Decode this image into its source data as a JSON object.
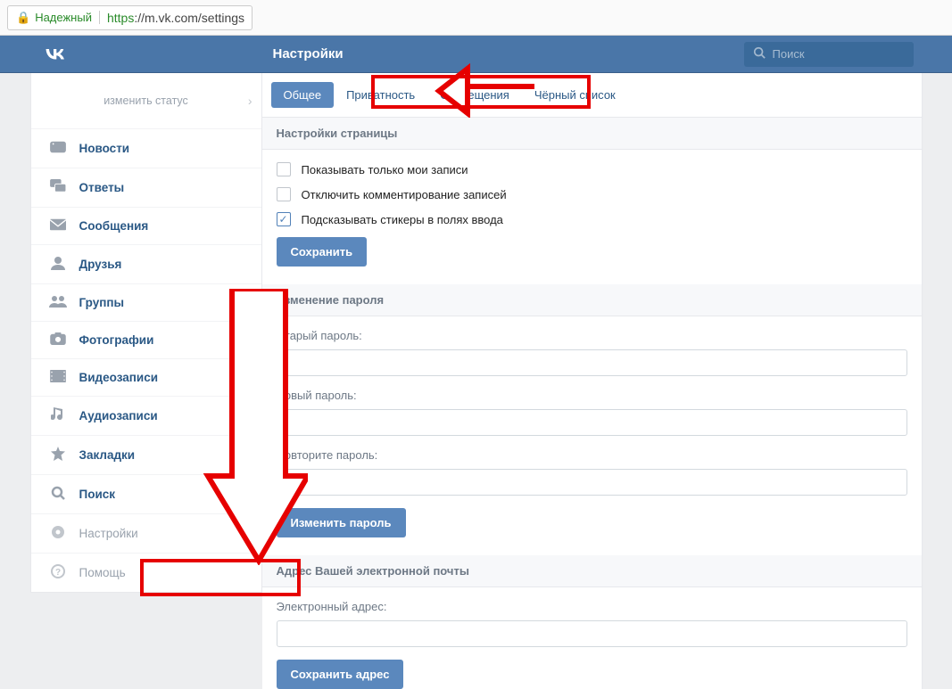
{
  "browser": {
    "secure_label": "Надежный",
    "url_https": "https",
    "url_rest": "://m.vk.com/settings"
  },
  "header": {
    "title": "Настройки",
    "search_placeholder": "Поиск"
  },
  "sidebar": {
    "status_label": "изменить статус",
    "items": {
      "news": "Новости",
      "replies": "Ответы",
      "messages": "Сообщения",
      "friends": "Друзья",
      "groups": "Группы",
      "photos": "Фотографии",
      "videos": "Видеозаписи",
      "audio": "Аудиозаписи",
      "bookmarks": "Закладки",
      "search": "Поиск",
      "settings": "Настройки",
      "help": "Помощь"
    }
  },
  "tabs": {
    "general": "Общее",
    "privacy": "Приватность",
    "notifications": "Оповещения",
    "blacklist": "Чёрный список"
  },
  "page_settings": {
    "heading": "Настройки страницы",
    "only_my_posts": "Показывать только мои записи",
    "disable_comments": "Отключить комментирование записей",
    "suggest_stickers": "Подсказывать стикеры в полях ввода",
    "save": "Сохранить"
  },
  "password": {
    "heading": "Изменение пароля",
    "old": "Старый пароль:",
    "new": "Новый пароль:",
    "repeat": "Повторите пароль:",
    "change": "Изменить пароль"
  },
  "email": {
    "heading": "Адрес Вашей электронной почты",
    "label": "Электронный адрес:",
    "save": "Сохранить адрес"
  }
}
